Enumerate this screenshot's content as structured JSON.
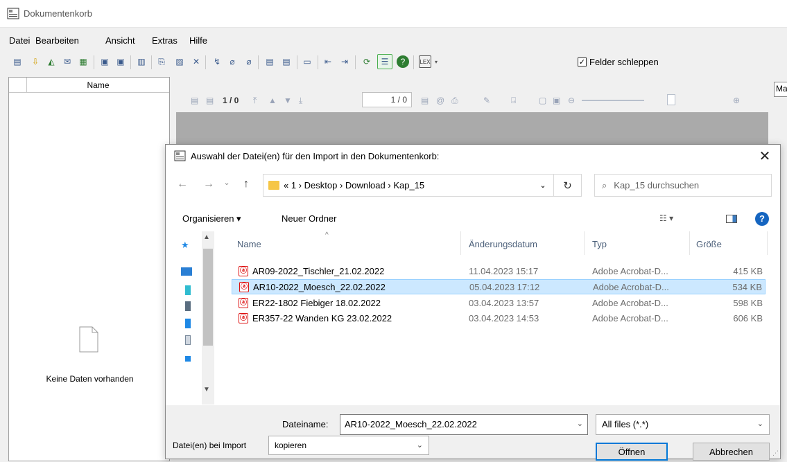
{
  "window": {
    "title": "Dokumentenkorb"
  },
  "menu": [
    "Datei",
    "Bearbeiten",
    "Ansicht",
    "Extras",
    "Hilfe"
  ],
  "toolbar": {
    "drag_fields_label": "Felder schleppen",
    "drag_fields_checked": true
  },
  "left_panel": {
    "column_header": "Name",
    "empty_text": "Keine Daten vorhanden"
  },
  "viewer": {
    "page_counter": "1 / 0",
    "page_input": "1 / 0",
    "right_field": "Ma"
  },
  "dialog": {
    "title": "Auswahl der Datei(en) für den Import in den Dokumentenkorb:",
    "breadcrumb": [
      "«",
      "1",
      "Desktop",
      "Download",
      "Kap_15"
    ],
    "search_placeholder": "Kap_15 durchsuchen",
    "organize_label": "Organisieren ▾",
    "new_folder_label": "Neuer Ordner",
    "columns": {
      "name": "Name",
      "date": "Änderungsdatum",
      "type": "Typ",
      "size": "Größe"
    },
    "files": [
      {
        "name": "AR09-2022_Tischler_21.02.2022",
        "date": "11.04.2023 15:17",
        "type": "Adobe Acrobat-D...",
        "size": "415 KB",
        "selected": false
      },
      {
        "name": "AR10-2022_Moesch_22.02.2022",
        "date": "05.04.2023 17:12",
        "type": "Adobe Acrobat-D...",
        "size": "534 KB",
        "selected": true
      },
      {
        "name": "ER22-1802 Fiebiger 18.02.2022",
        "date": "03.04.2023 13:57",
        "type": "Adobe Acrobat-D...",
        "size": "598 KB",
        "selected": false
      },
      {
        "name": "ER357-22 Wanden KG 23.02.2022",
        "date": "03.04.2023 14:53",
        "type": "Adobe Acrobat-D...",
        "size": "606 KB",
        "selected": false
      }
    ],
    "filename_label": "Dateiname:",
    "filename_value": "AR10-2022_Moesch_22.02.2022",
    "filter_value": "All files (*.*)",
    "open_label": "Öffnen",
    "cancel_label": "Abbrechen",
    "import_mode_label": "Datei(en) bei Import",
    "import_mode_value": "kopieren"
  },
  "colors": {
    "selection": "#cce8ff",
    "accent": "#0078d7",
    "pdf": "#d11111"
  }
}
